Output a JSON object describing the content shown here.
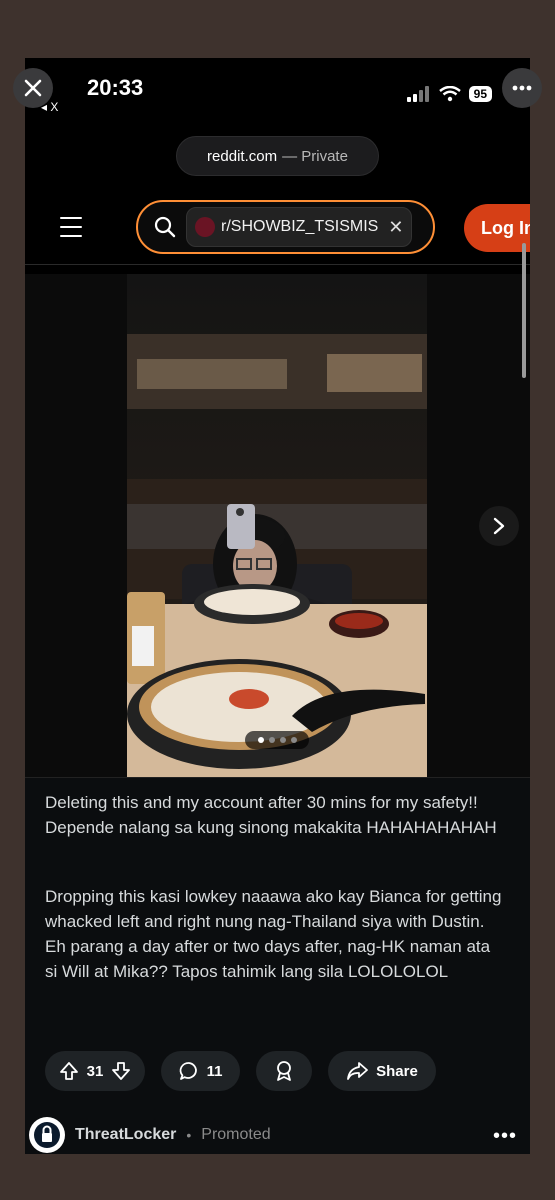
{
  "status": {
    "time": "20:33",
    "back_label": "◂ X",
    "battery": "95"
  },
  "browser": {
    "domain": "reddit.com",
    "mode": "— Private"
  },
  "nav": {
    "subreddit": "r/SHOWBIZ_TSISMIS",
    "login_label": "Log In",
    "accent": "#ff8f36",
    "login_color": "#d63f16"
  },
  "media": {
    "page_count": 4,
    "current_page": 1
  },
  "post": {
    "body_1": "Deleting this and my account after 30 mins for my safety!! Depende nalang sa kung sinong makakita HAHAHAHAHAH",
    "body_2": "Dropping this kasi lowkey naaawa ako kay Bianca for getting whacked left and right nung nag-Thailand siya with Dustin. Eh parang a day after or two days after, nag-HK naman ata si Will at Mika?? Tapos tahimik lang sila LOLOLOLOL",
    "votes": "31",
    "comments": "11",
    "share_label": "Share"
  },
  "promo": {
    "name": "ThreatLocker",
    "separator": "•",
    "tag": "Promoted"
  }
}
